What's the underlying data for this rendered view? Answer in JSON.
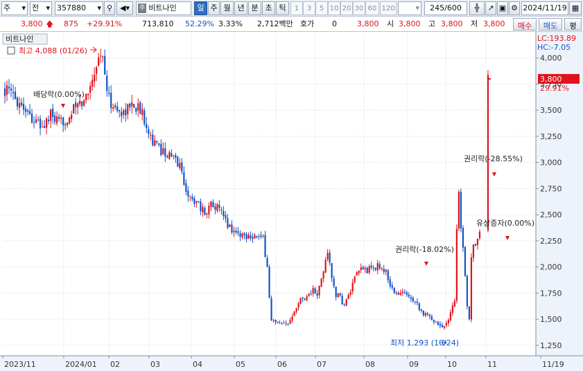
{
  "toolbar": {
    "market_label": "주",
    "market_code": "전",
    "stock_code": "357880",
    "stock_name": "비트나인",
    "stock_badge": "주",
    "periods": [
      "일",
      "주",
      "월",
      "년",
      "분",
      "초",
      "틱"
    ],
    "selected_period": "일",
    "interval_numbers": [
      "1",
      "3",
      "5",
      "10",
      "20",
      "30",
      "60",
      "120"
    ],
    "count_display": "245/600",
    "date": "2024/11/19"
  },
  "quote": {
    "price": "3,800",
    "change": "875",
    "change_pct": "+29.91%",
    "volume": "713,810",
    "volume_ratio": "52.29%",
    "turnover": "3.33%",
    "amount": "2,712백만",
    "hoga_label": "호가",
    "hoga_value": "0",
    "hoga_price": "3,800",
    "open_label": "시",
    "open": "3,800",
    "high_label": "고",
    "high": "3,800",
    "low_label": "저",
    "low": "3,800",
    "buy_label": "매수",
    "sell_label": "매도",
    "avg_label": "평"
  },
  "chart_data": {
    "type": "candlestick",
    "title": "비트나인",
    "ylim": [
      1150,
      4250
    ],
    "y_ticks": [
      "1,250",
      "1,500",
      "1,750",
      "2,000",
      "2,250",
      "2,500",
      "2,750",
      "3,000",
      "3,250",
      "3,500",
      "3,750",
      "4,000"
    ],
    "y_tick_values": [
      1250,
      1500,
      1750,
      2000,
      2250,
      2500,
      2750,
      3000,
      3250,
      3500,
      3750,
      4000
    ],
    "x_labels": [
      "2023/11",
      "2024/01",
      "02",
      "03",
      "04",
      "05",
      "06",
      "07",
      "08",
      "09",
      "10",
      "11",
      "11/19"
    ],
    "lc_label": "LC:193.89",
    "hc_label": "HC:-7.05",
    "current_price_label": "3,800",
    "current_change_label": "29.91%",
    "annotations": {
      "high": "최고 4,088 (01/26)",
      "low": "최저 1,293 (10/24)",
      "dividend": "배당락(0.00%)",
      "rights1": "권리락(-18.02%)",
      "rights2": "권리락(-28.55%)",
      "capital_increase": "유상증자(0.00%)"
    },
    "price_path": [
      [
        0,
        3700
      ],
      [
        6,
        3600
      ],
      [
        10,
        3520
      ],
      [
        14,
        3400
      ],
      [
        18,
        3330
      ],
      [
        22,
        3450
      ],
      [
        26,
        3360
      ],
      [
        30,
        3420
      ],
      [
        34,
        3530
      ],
      [
        38,
        3580
      ],
      [
        41,
        3750
      ],
      [
        43,
        3880
      ],
      [
        45,
        4000
      ],
      [
        47,
        4050
      ],
      [
        48,
        3800
      ],
      [
        50,
        3600
      ],
      [
        53,
        3520
      ],
      [
        56,
        3470
      ],
      [
        59,
        3520
      ],
      [
        62,
        3560
      ],
      [
        65,
        3500
      ],
      [
        68,
        3380
      ],
      [
        71,
        3200
      ],
      [
        74,
        3130
      ],
      [
        77,
        3100
      ],
      [
        79,
        3060
      ],
      [
        81,
        3040
      ],
      [
        84,
        2980
      ],
      [
        86,
        2800
      ],
      [
        88,
        2700
      ],
      [
        90,
        2620
      ],
      [
        92,
        2660
      ],
      [
        94,
        2560
      ],
      [
        96,
        2520
      ],
      [
        98,
        2570
      ],
      [
        100,
        2620
      ],
      [
        103,
        2540
      ],
      [
        106,
        2440
      ],
      [
        109,
        2360
      ],
      [
        112,
        2320
      ],
      [
        115,
        2300
      ],
      [
        118,
        2310
      ],
      [
        121,
        2290
      ],
      [
        124,
        2260
      ],
      [
        126,
        2000
      ],
      [
        127,
        1700
      ],
      [
        128,
        1500
      ],
      [
        130,
        1460
      ],
      [
        133,
        1440
      ],
      [
        136,
        1450
      ],
      [
        139,
        1600
      ],
      [
        142,
        1690
      ],
      [
        145,
        1720
      ],
      [
        148,
        1780
      ],
      [
        150,
        1720
      ],
      [
        153,
        1960
      ],
      [
        155,
        2160
      ],
      [
        157,
        1880
      ],
      [
        159,
        1740
      ],
      [
        161,
        1700
      ],
      [
        163,
        1630
      ],
      [
        165,
        1720
      ],
      [
        168,
        1880
      ],
      [
        171,
        1990
      ],
      [
        174,
        1970
      ],
      [
        177,
        1990
      ],
      [
        180,
        2010
      ],
      [
        183,
        1950
      ],
      [
        186,
        1780
      ],
      [
        189,
        1730
      ],
      [
        192,
        1760
      ],
      [
        195,
        1720
      ],
      [
        198,
        1650
      ],
      [
        201,
        1550
      ],
      [
        204,
        1520
      ],
      [
        207,
        1480
      ],
      [
        210,
        1420
      ],
      [
        213,
        1510
      ],
      [
        216,
        1680
      ],
      [
        217,
        2400
      ],
      [
        218,
        2700
      ],
      [
        219,
        2350
      ],
      [
        220,
        2150
      ],
      [
        221,
        1900
      ],
      [
        222,
        1650
      ],
      [
        223,
        1520
      ],
      [
        224,
        2100
      ],
      [
        225,
        2250
      ],
      [
        226,
        2180
      ],
      [
        228,
        2300
      ],
      [
        232,
        3800
      ]
    ]
  }
}
